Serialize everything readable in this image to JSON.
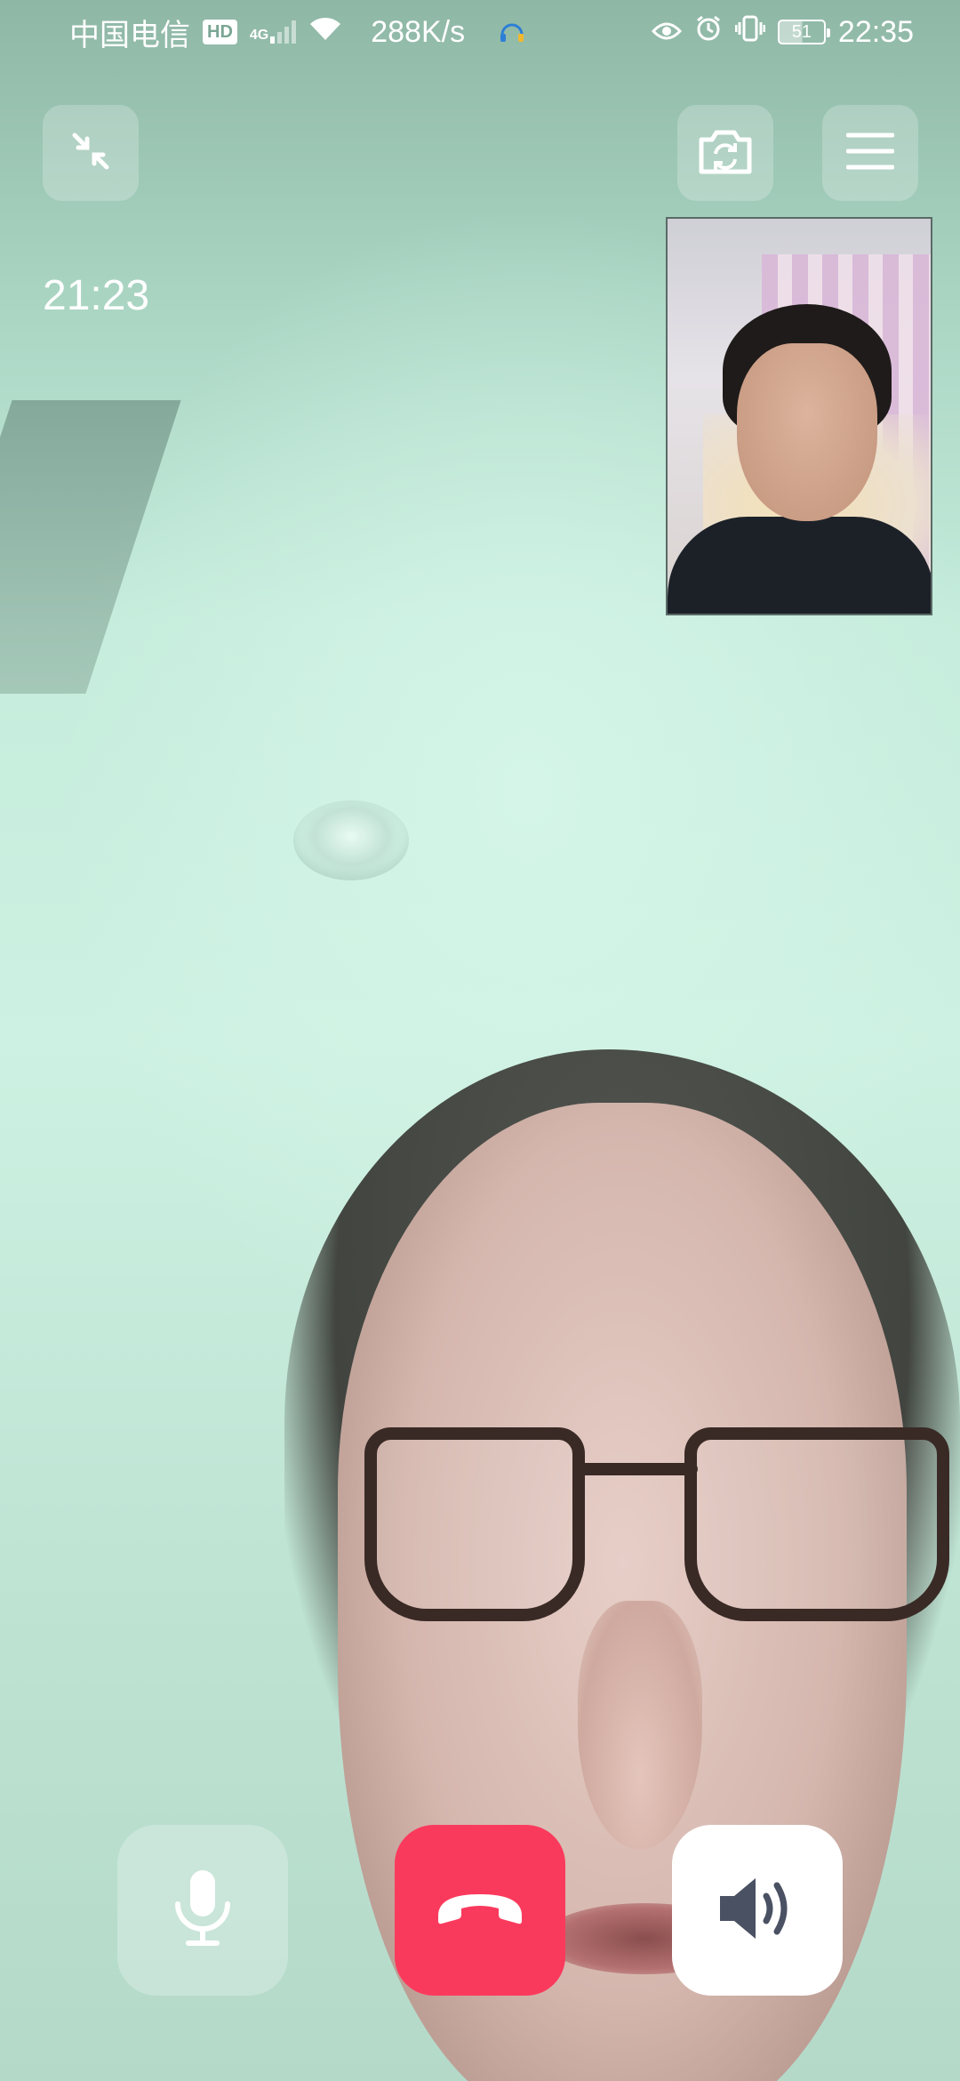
{
  "status_bar": {
    "carrier": "中国电信",
    "hd_badge": "HD",
    "network_type": "4G",
    "net_speed": "288K/s",
    "battery_level": "51",
    "time": "22:35",
    "icons": [
      "hd-icon",
      "signal-icon",
      "wifi-icon",
      "headset-icon",
      "eye-icon",
      "alarm-icon",
      "vibrate-icon",
      "battery-icon"
    ]
  },
  "call": {
    "duration": "21:23",
    "top_controls": [
      "minimize-icon",
      "switch-camera-icon",
      "menu-icon"
    ],
    "bottom_controls": [
      "microphone-icon",
      "hang-up-icon",
      "speaker-icon"
    ]
  },
  "colors": {
    "hangup": "#fa3a5c",
    "speaker_bg": "#ffffff",
    "speaker_icon": "#4a5163",
    "control_bg": "rgba(255,255,255,0.22)"
  }
}
